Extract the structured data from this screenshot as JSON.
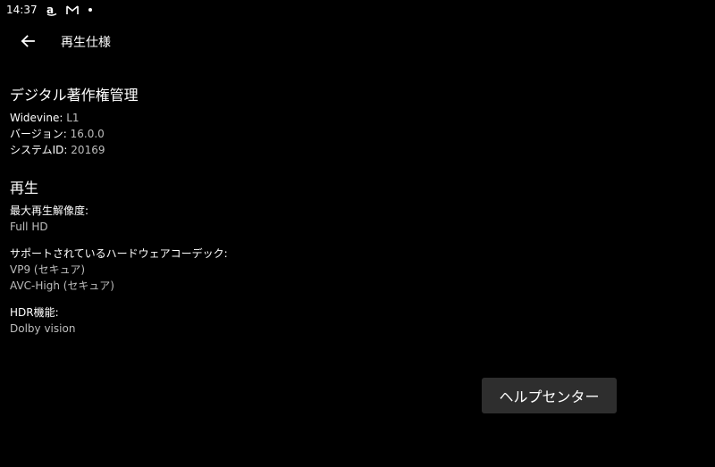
{
  "status_bar": {
    "time": "14:37",
    "icons": [
      "amazon-icon",
      "gmail-icon",
      "notification-dot-icon"
    ]
  },
  "app_bar": {
    "title": "再生仕様",
    "back_icon": "arrow-left-icon"
  },
  "drm": {
    "title": "デジタル著作権管理",
    "widevine_key": "Widevine:",
    "widevine_val": "L1",
    "version_key": "バージョン:",
    "version_val": "16.0.0",
    "system_id_key": "システムID:",
    "system_id_val": "20169"
  },
  "playback": {
    "title": "再生",
    "max_resolution_label": "最大再生解像度:",
    "max_resolution_value": "Full HD",
    "codecs_label": "サポートされているハードウェアコーデック:",
    "codecs": [
      "VP9 (セキュア)",
      "AVC-High (セキュア)"
    ],
    "hdr_label": "HDR機能:",
    "hdr_value": "Dolby vision"
  },
  "help_button": {
    "label": "ヘルプセンター"
  },
  "colors": {
    "background": "#000000",
    "text_primary": "#ffffff",
    "text_secondary": "#bdbdbd",
    "button_bg": "#2e2e2e"
  }
}
